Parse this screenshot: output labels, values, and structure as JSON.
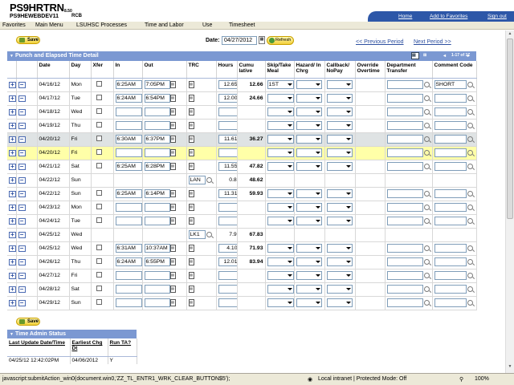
{
  "app": {
    "logo": "PS9HRTRN",
    "version": "8.50",
    "server": "PS9HEWEBDEV11",
    "user": "RCB"
  },
  "toplinks": {
    "home": "Home",
    "favorites": "Add to Favorites",
    "signout": "Sign out"
  },
  "breadcrumb": [
    "Favorites",
    "Main Menu",
    "LSUHSC Processes",
    "Time and Labor",
    "Use",
    "Timesheet"
  ],
  "toolbar": {
    "save_label": "Save",
    "date_label": "Date:",
    "date_value": "04/27/2012",
    "refresh_label": "Refresh",
    "prev_period": "<< Previous Period",
    "next_period": "Next Period >>"
  },
  "grid": {
    "title": "Punch and Elapsed Time Detail",
    "pager": "1-17 of 17",
    "columns": [
      "Date",
      "Day",
      "Xfer",
      "In",
      "Out",
      "TRC",
      "Hours",
      "Cumu lative",
      "Skip/Take Meal",
      "Hazard/ In Chrg",
      "Callback/ NoPay",
      "Override Overtime",
      "Department Transfer",
      "Comment Code"
    ],
    "rows": [
      {
        "date": "04/16/12",
        "day": "Mon",
        "in": "6:25AM",
        "out": "7:05PM",
        "trc": "",
        "hours": "12.65",
        "cumulative": "12.66",
        "meal": "1ST",
        "comment": "SHORT",
        "style": "",
        "full": true
      },
      {
        "date": "04/17/12",
        "day": "Tue",
        "in": "6:24AM",
        "out": "6:54PM",
        "trc": "",
        "hours": "12.00",
        "cumulative": "24.66",
        "meal": "",
        "comment": "",
        "style": "",
        "full": true
      },
      {
        "date": "04/18/12",
        "day": "Wed",
        "in": "",
        "out": "",
        "trc": "",
        "hours": "",
        "cumulative": "",
        "meal": "",
        "comment": "",
        "style": "",
        "full": true
      },
      {
        "date": "04/19/12",
        "day": "Thu",
        "in": "",
        "out": "",
        "trc": "",
        "hours": "",
        "cumulative": "",
        "meal": "",
        "comment": "",
        "style": "",
        "full": true
      },
      {
        "date": "04/20/12",
        "day": "Fri",
        "in": "6:30AM",
        "out": "6:37PM",
        "trc": "",
        "hours": "11.61",
        "cumulative": "36.27",
        "meal": "",
        "comment": "",
        "style": "gray",
        "full": true
      },
      {
        "date": "04/20/12",
        "day": "Fri",
        "in": "",
        "out": "",
        "trc": "",
        "hours": "",
        "cumulative": "",
        "meal": "",
        "comment": "",
        "style": "yellow",
        "full": true
      },
      {
        "date": "04/21/12",
        "day": "Sat",
        "in": "6:25AM",
        "out": "6:28PM",
        "trc": "",
        "hours": "11.55",
        "cumulative": "47.82",
        "meal": "",
        "comment": "",
        "style": "",
        "full": true
      },
      {
        "date": "04/22/12",
        "day": "Sun",
        "in": "",
        "out": "",
        "trc": "LAN",
        "hours": "0.80",
        "cumulative": "48.62",
        "meal": "",
        "comment": "",
        "style": "",
        "full": false
      },
      {
        "date": "04/22/12",
        "day": "Sun",
        "in": "6:25AM",
        "out": "6:14PM",
        "trc": "",
        "hours": "11.31",
        "cumulative": "59.93",
        "meal": "",
        "comment": "",
        "style": "",
        "full": true
      },
      {
        "date": "04/23/12",
        "day": "Mon",
        "in": "",
        "out": "",
        "trc": "",
        "hours": "",
        "cumulative": "",
        "meal": "",
        "comment": "",
        "style": "",
        "full": true
      },
      {
        "date": "04/24/12",
        "day": "Tue",
        "in": "",
        "out": "",
        "trc": "",
        "hours": "",
        "cumulative": "",
        "meal": "",
        "comment": "",
        "style": "",
        "full": true
      },
      {
        "date": "04/25/12",
        "day": "Wed",
        "in": "",
        "out": "",
        "trc": "LK1",
        "hours": "7.90",
        "cumulative": "67.83",
        "meal": "",
        "comment": "",
        "style": "",
        "full": false
      },
      {
        "date": "04/25/12",
        "day": "Wed",
        "in": "6:31AM",
        "out": "10:37AM",
        "trc": "",
        "hours": "4.10",
        "cumulative": "71.93",
        "meal": "",
        "comment": "",
        "style": "",
        "full": true
      },
      {
        "date": "04/26/12",
        "day": "Thu",
        "in": "6:24AM",
        "out": "6:55PM",
        "trc": "",
        "hours": "12.01",
        "cumulative": "83.94",
        "meal": "",
        "comment": "",
        "style": "",
        "full": true
      },
      {
        "date": "04/27/12",
        "day": "Fri",
        "in": "",
        "out": "",
        "trc": "",
        "hours": "",
        "cumulative": "",
        "meal": "",
        "comment": "",
        "style": "",
        "full": true
      },
      {
        "date": "04/28/12",
        "day": "Sat",
        "in": "",
        "out": "",
        "trc": "",
        "hours": "",
        "cumulative": "",
        "meal": "",
        "comment": "",
        "style": "",
        "full": true
      },
      {
        "date": "04/29/12",
        "day": "Sun",
        "in": "",
        "out": "",
        "trc": "",
        "hours": "",
        "cumulative": "",
        "meal": "",
        "comment": "",
        "style": "",
        "full": true
      }
    ]
  },
  "status_panel": {
    "title": "Time Admin Status",
    "columns": [
      "Last Update Date/Time",
      "Earliest Chg Dt",
      "Run TA?"
    ],
    "row": [
      "04/25/12 12:42:02PM",
      "04/06/2012",
      "Y"
    ]
  },
  "statusbar": {
    "script": "javascript:submitAction_win0(document.win0,'ZZ_TL_ENTR1_WRK_CLEAR_BUTTON$5');",
    "zone": "Local intranet | Protected Mode: Off",
    "zoom": "100%"
  },
  "colors": {
    "header_blue": "#7b98d2",
    "link_blue": "#2d4fa0",
    "highlight_gray": "#dfe3e4",
    "highlight_yellow": "#ffffa8"
  }
}
